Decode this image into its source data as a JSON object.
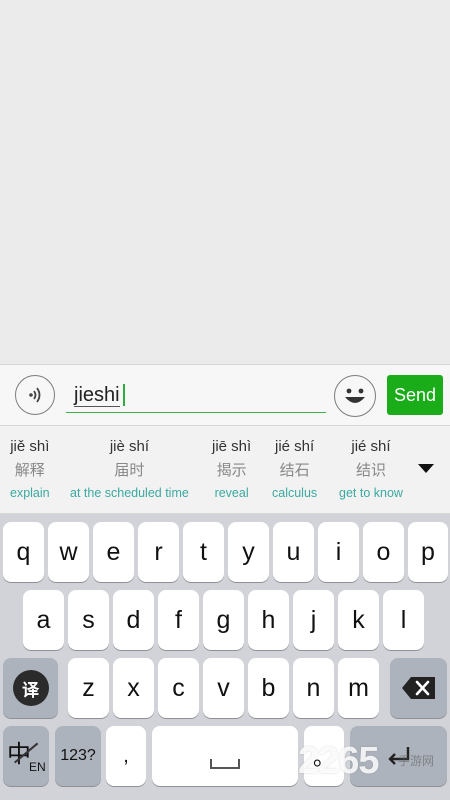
{
  "input_bar": {
    "text_value": "jieshi",
    "send_label": "Send",
    "accent_color": "#1aad19"
  },
  "candidates": [
    {
      "pinyin": "jiě shì",
      "hanzi": "解释",
      "english": "explain"
    },
    {
      "pinyin": "jiè shí",
      "hanzi": "届时",
      "english": "at the scheduled time"
    },
    {
      "pinyin": "jiē shì",
      "hanzi": "揭示",
      "english": "reveal"
    },
    {
      "pinyin": "jié shí",
      "hanzi": "结石",
      "english": "calculus"
    },
    {
      "pinyin": "jié shí",
      "hanzi": "结识",
      "english": "get to know"
    }
  ],
  "keyboard": {
    "row1": [
      "q",
      "w",
      "e",
      "r",
      "t",
      "y",
      "u",
      "i",
      "o",
      "p"
    ],
    "row2": [
      "a",
      "s",
      "d",
      "f",
      "g",
      "h",
      "j",
      "k",
      "l"
    ],
    "row3": [
      "z",
      "x",
      "c",
      "v",
      "b",
      "n",
      "m"
    ],
    "translate_label": "译",
    "lang_main": "中",
    "lang_sub": "EN",
    "numbers_label": "123?",
    "comma_label": ",",
    "period_label": "。"
  },
  "icons": {
    "voice": "voice-icon",
    "emoji": "emoji-icon",
    "backspace": "backspace-icon",
    "return": "return-icon",
    "more": "chevron-down-icon"
  },
  "watermark": {
    "text": "2265",
    "sub": "手游网"
  }
}
